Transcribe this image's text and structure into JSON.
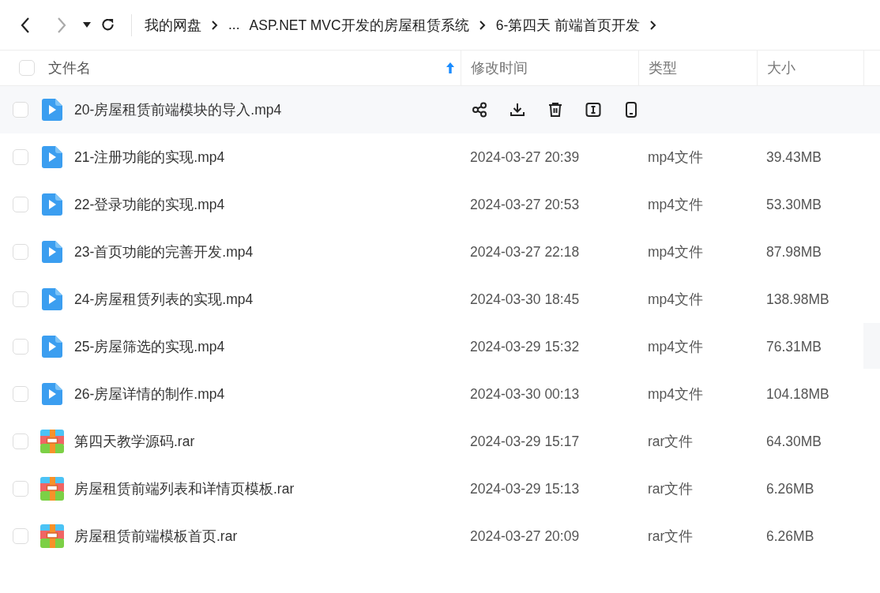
{
  "nav": {
    "back": {
      "disabled": false
    },
    "forward": {
      "disabled": true
    }
  },
  "breadcrumb": [
    {
      "label": "我的网盘",
      "kind": "link"
    },
    {
      "label": "...",
      "kind": "ellipsis"
    },
    {
      "label": "ASP.NET MVC开发的房屋租赁系统",
      "kind": "link"
    },
    {
      "label": "6-第四天 前端首页开发",
      "kind": "current"
    }
  ],
  "table": {
    "select_all": {
      "checked": false
    },
    "columns": [
      {
        "label": "文件名",
        "sorted": true
      },
      {
        "label": "修改时间",
        "sorted": false
      },
      {
        "label": "类型",
        "sorted": false
      },
      {
        "label": "大小",
        "sorted": false
      }
    ],
    "rows": [
      {
        "name": "20-房屋租赁前端模块的导入.mp4",
        "kind": "video",
        "hovered": true
      },
      {
        "name": "21-注册功能的实现.mp4",
        "kind": "video",
        "hovered": false,
        "modified": "2024-03-27 20:39",
        "type": "mp4文件",
        "size": "39.43MB"
      },
      {
        "name": "22-登录功能的实现.mp4",
        "kind": "video",
        "hovered": false,
        "modified": "2024-03-27 20:53",
        "type": "mp4文件",
        "size": "53.30MB"
      },
      {
        "name": "23-首页功能的完善开发.mp4",
        "kind": "video",
        "hovered": false,
        "modified": "2024-03-27 22:18",
        "type": "mp4文件",
        "size": "87.98MB"
      },
      {
        "name": "24-房屋租赁列表的实现.mp4",
        "kind": "video",
        "hovered": false,
        "modified": "2024-03-30 18:45",
        "type": "mp4文件",
        "size": "138.98MB"
      },
      {
        "name": "25-房屋筛选的实现.mp4",
        "kind": "video",
        "hovered": false,
        "modified": "2024-03-29 15:32",
        "type": "mp4文件",
        "size": "76.31MB"
      },
      {
        "name": "26-房屋详情的制作.mp4",
        "kind": "video",
        "hovered": false,
        "modified": "2024-03-30 00:13",
        "type": "mp4文件",
        "size": "104.18MB"
      },
      {
        "name": "第四天教学源码.rar",
        "kind": "archive",
        "hovered": false,
        "modified": "2024-03-29 15:17",
        "type": "rar文件",
        "size": "64.30MB"
      },
      {
        "name": "房屋租赁前端列表和详情页模板.rar",
        "kind": "archive",
        "hovered": false,
        "modified": "2024-03-29 15:13",
        "type": "rar文件",
        "size": "6.26MB"
      },
      {
        "name": "房屋租赁前端模板首页.rar",
        "kind": "archive",
        "hovered": false,
        "modified": "2024-03-27 20:09",
        "type": "rar文件",
        "size": "6.26MB"
      }
    ]
  }
}
